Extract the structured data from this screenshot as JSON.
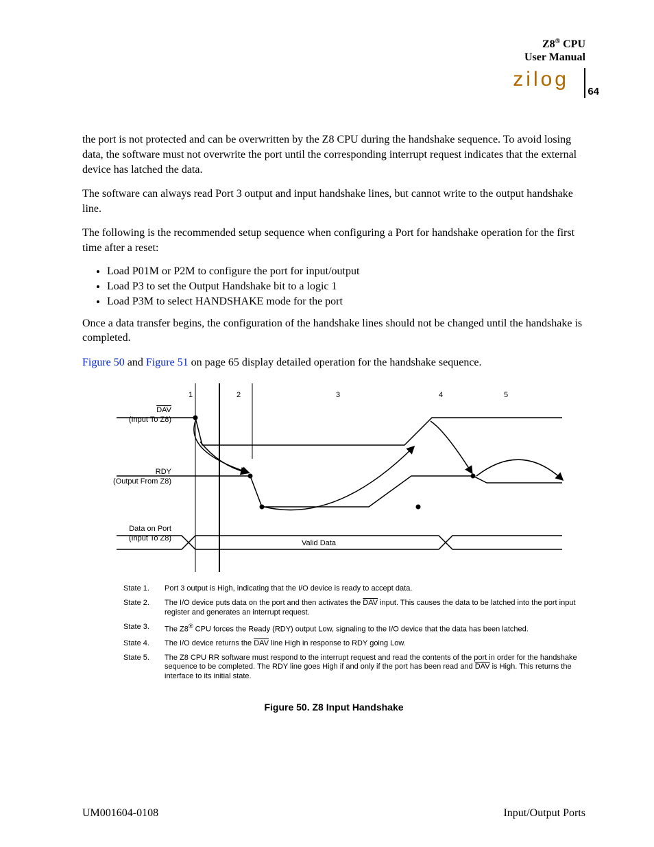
{
  "header": {
    "line1_a": "Z8",
    "line1_b": " CPU",
    "line2": "User Manual",
    "logo": "zilog",
    "page": "64"
  },
  "paragraphs": {
    "p1": "the port is not protected and can be overwritten by the Z8 CPU during the handshake sequence. To avoid losing data, the software must not overwrite the port until the corresponding interrupt request indicates that the external device has latched the data.",
    "p2": "The software can always read Port 3 output and input handshake lines, but cannot write to the output handshake line.",
    "p3": "The following is the recommended setup sequence when configuring a Port for handshake operation for the first time after a reset:",
    "p4": "Once a data transfer begins, the configuration of the handshake lines should not be changed until the handshake is completed.",
    "p5_a": "Figure 50",
    "p5_b": " and ",
    "p5_c": "Figure 51",
    "p5_d": " on page 65 display detailed operation for the handshake sequence."
  },
  "bullets": [
    "Load P01M or P2M to configure the port for input/output",
    "Load P3 to set the Output Handshake bit to a logic 1",
    "Load P3M to select HANDSHAKE mode for the port"
  ],
  "diagram": {
    "ticks": [
      "1",
      "2",
      "3",
      "4",
      "5"
    ],
    "sig1_name": "DAV",
    "sig1_sub": "(Input To Z8)",
    "sig2_name": "RDY",
    "sig2_sub": "(Output From Z8)",
    "sig3_name": "Data on Port",
    "sig3_sub": "(Input To Z8)",
    "valid": "Valid Data"
  },
  "states": [
    {
      "label": "State 1.",
      "text": "Port 3 output is High, indicating that the I/O device is ready to accept data."
    },
    {
      "label": "State 2.",
      "text_a": "The I/O device puts data on the port and then activates the ",
      "dav": "DAV",
      "text_b": " input.  This causes the data to be latched into the port input register and generates an interrupt request."
    },
    {
      "label": "State 3.",
      "text_a": "The Z8",
      "sup": "®",
      "text_b": " CPU forces the Ready (RDY) output Low, signaling to the I/O device that the data has been latched."
    },
    {
      "label": "State 4.",
      "text_a": "The I/O device returns the ",
      "dav": "DAV",
      "text_b": " line High in response to RDY going Low."
    },
    {
      "label": "State 5.",
      "text_a": "The Z8 CPU RR software must respond to the interrupt request and read the contents of the port in order for the handshake sequence to be completed.  The RDY line goes High if and only if the port has been read and ",
      "dav": "DAV",
      "text_b": " is High.  This returns the interface to its initial state."
    }
  ],
  "figure_caption": "Figure 50. Z8 Input Handshake",
  "footer": {
    "left": "UM001604-0108",
    "right": "Input/Output Ports"
  }
}
